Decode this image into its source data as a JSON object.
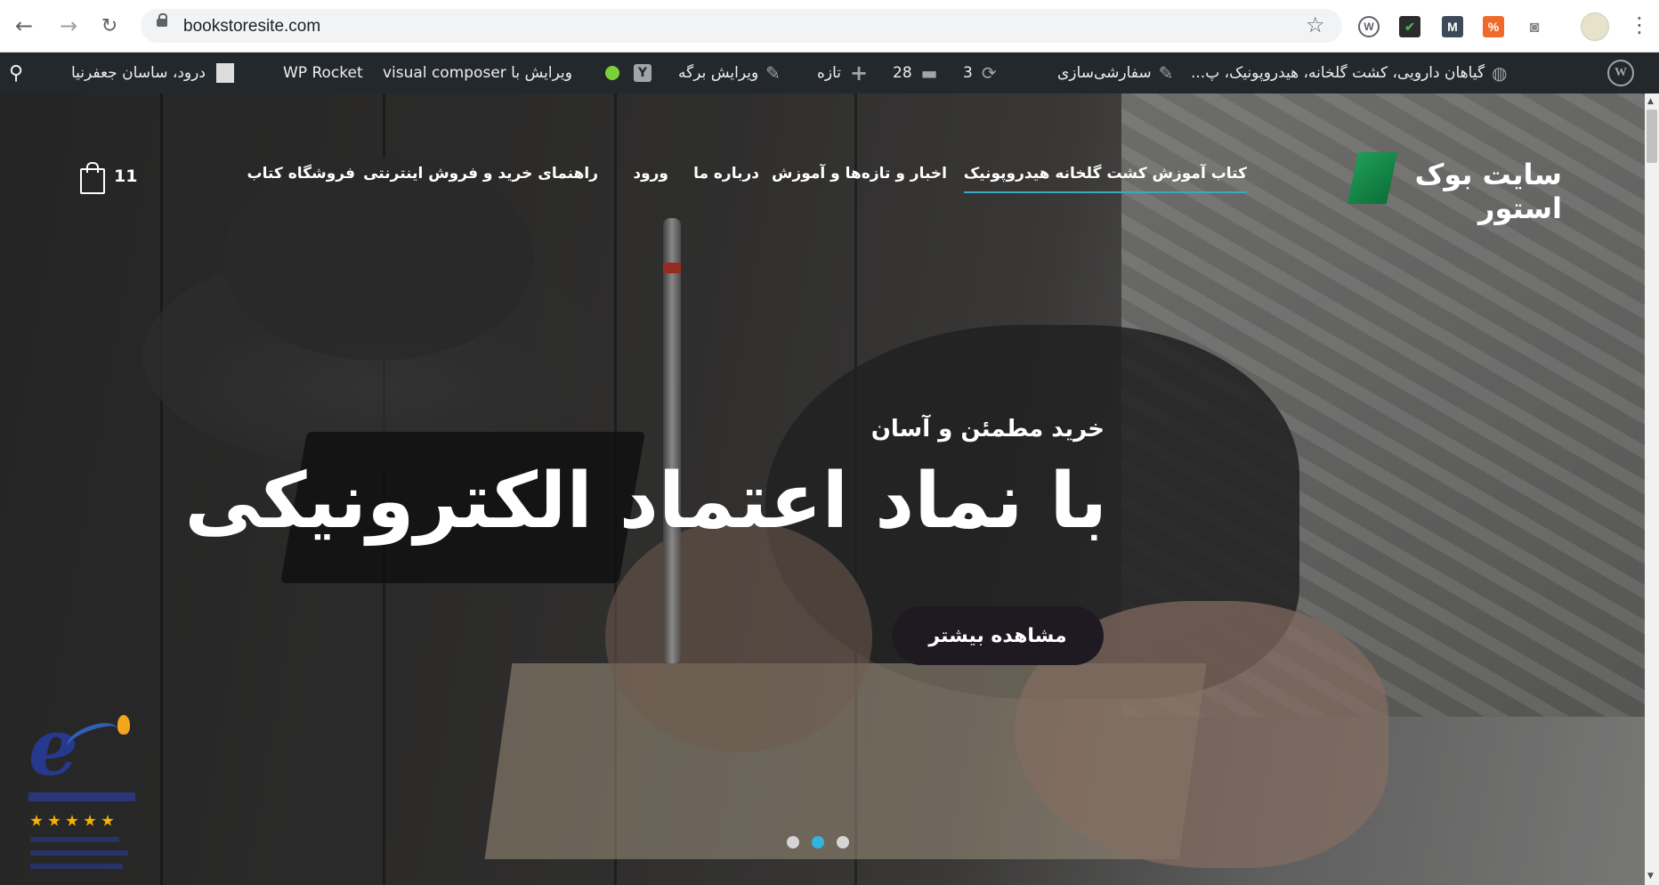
{
  "browser": {
    "url": "bookstoresite.com",
    "back_icon": "arrow-left-icon",
    "forward_icon": "arrow-right-icon",
    "reload_icon": "reload-icon",
    "extensions": [
      {
        "name": "wordpress-extension-icon",
        "label": "W",
        "color": "#5f6368"
      },
      {
        "name": "checkmark-extension-icon",
        "label": "✔",
        "color": "#2b2b2b"
      },
      {
        "name": "gmail-extension-icon",
        "label": "M",
        "color": "#3c4a5a"
      },
      {
        "name": "percent-extension-icon",
        "label": "%",
        "color": "#ef6a2a"
      },
      {
        "name": "camera-extension-icon",
        "label": "◙",
        "color": "#8a8a8a"
      }
    ]
  },
  "adminbar": {
    "site_name": "گیاهان دارویی، کشت گلخانه، هیدروپونیک، پ...",
    "customize": "سفارشی‌سازی",
    "updates_count": "3",
    "comments_count": "28",
    "new_label": "تازه",
    "edit_page": "ویرایش برگه",
    "visual_composer": "ویرایش با visual composer",
    "wp_rocket": "WP Rocket",
    "greeting": "درود، ساسان جعفرنیا"
  },
  "site": {
    "logo_text": "سایت بوک استور",
    "menu": [
      "کتاب آموزش کشت گلخانه هیدروپونیک",
      "اخبار و تازه‌ها و آموزش",
      "درباره ما",
      "ورود",
      "راهنمای خرید و فروش اینترنتی",
      "فروشگاه کتاب"
    ],
    "cart_count": "11"
  },
  "hero": {
    "subtitle": "خرید مطمئن و آسان",
    "headline": "با نماد اعتماد الکترونیکی",
    "cta": "مشاهده بیشتر",
    "slide_count": 3,
    "active_slide": 2
  },
  "colors": {
    "adminbar_bg": "#23282d",
    "accent_underline": "#39a9c6",
    "active_dot": "#31b5e0",
    "cta_bg": "#1f1a22"
  }
}
